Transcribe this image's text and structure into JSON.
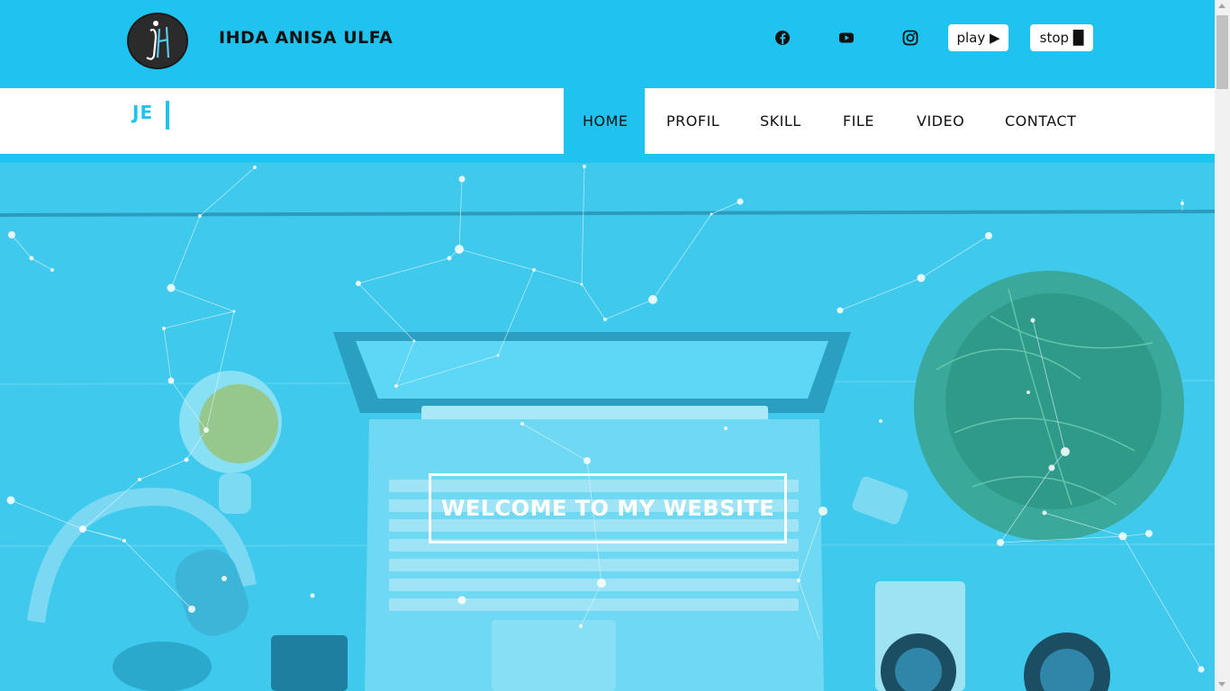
{
  "header": {
    "logo_icon": "ia-monogram-logo",
    "site_name": "IHDA ANISA ULFA",
    "social": [
      {
        "name": "facebook-icon"
      },
      {
        "name": "youtube-icon"
      },
      {
        "name": "instagram-icon"
      }
    ],
    "play_label": "play ▶",
    "stop_label": "stop █"
  },
  "nav": {
    "typed_text": "JE",
    "items": [
      "HOME",
      "PROFIL",
      "SKILL",
      "FILE",
      "VIDEO",
      "CONTACT"
    ],
    "active": "HOME"
  },
  "hero": {
    "welcome_text": "WELCOME TO MY WEBSITE"
  },
  "colors": {
    "accent": "#1ec3ef",
    "hero_overlay": "#3cc8ec",
    "text_dark": "#111111"
  }
}
